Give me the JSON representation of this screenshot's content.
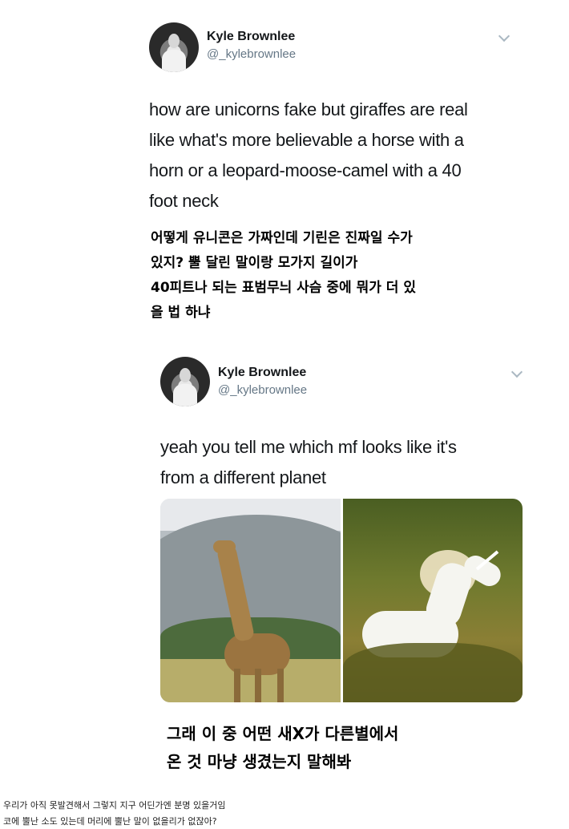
{
  "tweet1": {
    "author": "Kyle Brownlee",
    "handle": "@_kylebrownlee",
    "text": "how are unicorns fake but giraffes are real like what's more believable a horse with a horn or a leopard-moose-camel with a 40 foot neck",
    "lines": [
      "how are unicorns fake but giraffes are real",
      "like what's more believable a horse with a",
      "horn or a leopard-moose-camel with a 40",
      "foot neck"
    ],
    "translation": [
      "어떻게 유니콘은 가짜인데 기린은 진짜일 수가",
      "있지? 뿔 달린 말이랑 모가지 길이가",
      "40피트나 되는 표범무늬 사슴 중에 뭐가 더 있",
      "을 법 하냐"
    ]
  },
  "tweet2": {
    "author": "Kyle Brownlee",
    "handle": "@_kylebrownlee",
    "lines": [
      "yeah you tell me which mf looks like it's",
      "from a different planet"
    ],
    "images": [
      "giraffe-photo",
      "unicorn-photo"
    ],
    "translation": [
      "그래 이 중 어떤 새X가 다른별에서",
      "온 것 마냥 생겼는지 말해봐"
    ]
  },
  "footer": {
    "comment1": "우리가 아직 못발견해서 그렇지 지구 어딘가엔 분명 있을거임",
    "comment2": "코에 뿔난 소도 있는데 머리에 뿔난 말이 없을리가 없잖아?"
  },
  "icons": {
    "menu": "chevron-down-icon"
  },
  "colors": {
    "text": "#14171a",
    "handle": "#657786",
    "chevron": "#aab8c2"
  }
}
